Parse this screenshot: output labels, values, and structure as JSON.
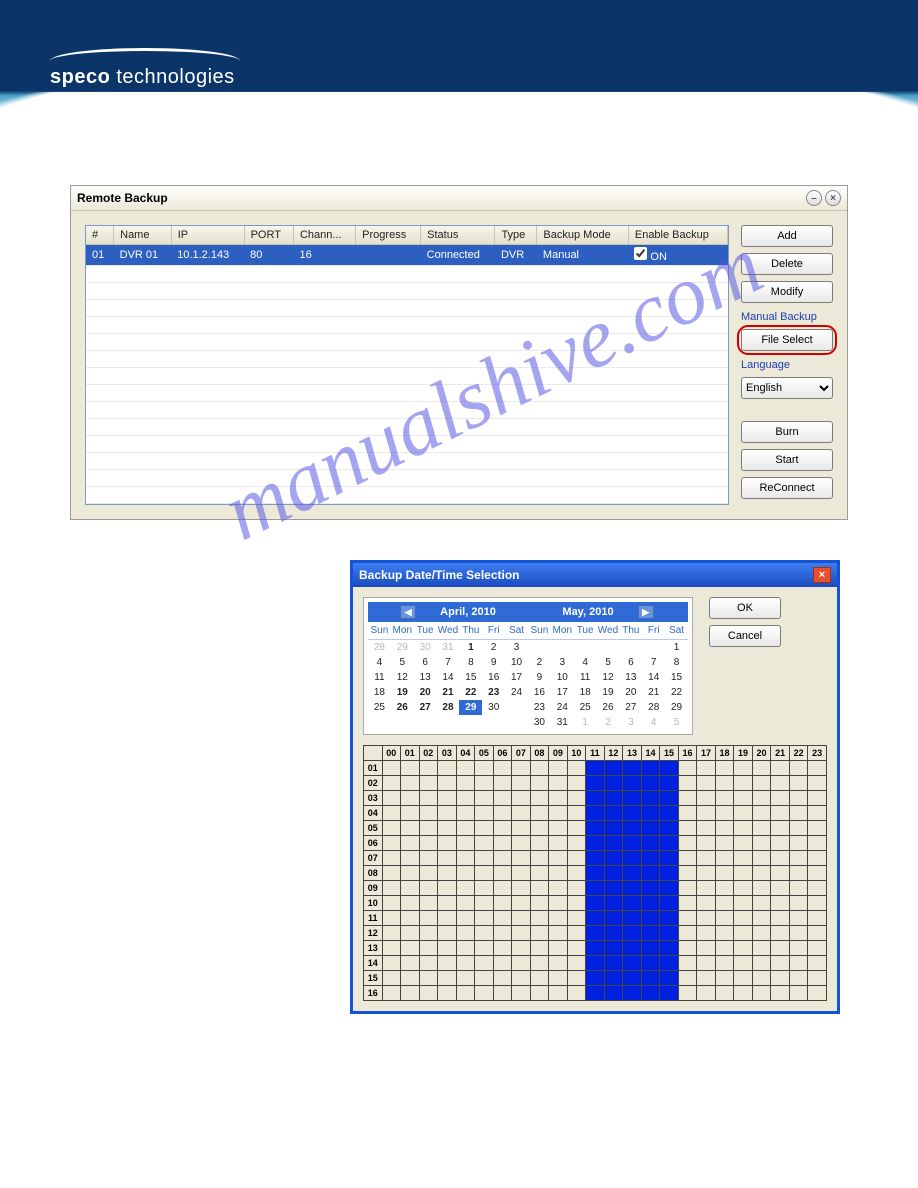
{
  "brand": {
    "name": "speco",
    "suffix": " technologies"
  },
  "watermark": "manualshive.com",
  "remoteBackup": {
    "title": "Remote Backup",
    "minIcon": "–",
    "closeIcon": "×",
    "headers": [
      "#",
      "Name",
      "IP",
      "PORT",
      "Chann...",
      "Progress",
      "Status",
      "Type",
      "Backup Mode",
      "Enable Backup"
    ],
    "row": {
      "num": "01",
      "name": "DVR 01",
      "ip": "10.1.2.143",
      "port": "80",
      "chan": "16",
      "progress": "",
      "status": "Connected",
      "type": "DVR",
      "mode": "Manual",
      "enable": "ON"
    },
    "buttons": {
      "add": "Add",
      "delete": "Delete",
      "modify": "Modify",
      "manualBackup": "Manual Backup",
      "fileSelect": "File Select",
      "language": "Language",
      "langValue": "English",
      "burn": "Burn",
      "start": "Start",
      "reconnect": "ReConnect"
    }
  },
  "dateDialog": {
    "title": "Backup Date/Time Selection",
    "close": "×",
    "ok": "OK",
    "cancel": "Cancel",
    "dayHeaders": [
      "Sun",
      "Mon",
      "Tue",
      "Wed",
      "Thu",
      "Fri",
      "Sat"
    ],
    "calendars": [
      {
        "label": "April, 2010",
        "prev": true,
        "next": false,
        "days": [
          {
            "n": "28",
            "off": true
          },
          {
            "n": "29",
            "off": true
          },
          {
            "n": "30",
            "off": true
          },
          {
            "n": "31",
            "off": true
          },
          {
            "n": "1",
            "b": true
          },
          {
            "n": "2"
          },
          {
            "n": "3"
          },
          {
            "n": "4"
          },
          {
            "n": "5"
          },
          {
            "n": "6"
          },
          {
            "n": "7"
          },
          {
            "n": "8"
          },
          {
            "n": "9"
          },
          {
            "n": "10"
          },
          {
            "n": "11"
          },
          {
            "n": "12"
          },
          {
            "n": "13"
          },
          {
            "n": "14"
          },
          {
            "n": "15"
          },
          {
            "n": "16"
          },
          {
            "n": "17"
          },
          {
            "n": "18"
          },
          {
            "n": "19",
            "b": true
          },
          {
            "n": "20",
            "b": true
          },
          {
            "n": "21",
            "b": true
          },
          {
            "n": "22",
            "b": true
          },
          {
            "n": "23",
            "b": true
          },
          {
            "n": "24"
          },
          {
            "n": "25"
          },
          {
            "n": "26",
            "b": true
          },
          {
            "n": "27",
            "b": true
          },
          {
            "n": "28",
            "b": true
          },
          {
            "n": "29",
            "b": true,
            "today": true
          },
          {
            "n": "30"
          },
          {
            "n": ""
          }
        ]
      },
      {
        "label": "May, 2010",
        "prev": false,
        "next": true,
        "days": [
          {
            "n": ""
          },
          {
            "n": ""
          },
          {
            "n": ""
          },
          {
            "n": ""
          },
          {
            "n": ""
          },
          {
            "n": ""
          },
          {
            "n": "1"
          },
          {
            "n": "2"
          },
          {
            "n": "3"
          },
          {
            "n": "4"
          },
          {
            "n": "5"
          },
          {
            "n": "6"
          },
          {
            "n": "7"
          },
          {
            "n": "8"
          },
          {
            "n": "9"
          },
          {
            "n": "10"
          },
          {
            "n": "11"
          },
          {
            "n": "12"
          },
          {
            "n": "13"
          },
          {
            "n": "14"
          },
          {
            "n": "15"
          },
          {
            "n": "16"
          },
          {
            "n": "17"
          },
          {
            "n": "18"
          },
          {
            "n": "19"
          },
          {
            "n": "20"
          },
          {
            "n": "21"
          },
          {
            "n": "22"
          },
          {
            "n": "23"
          },
          {
            "n": "24"
          },
          {
            "n": "25"
          },
          {
            "n": "26"
          },
          {
            "n": "27"
          },
          {
            "n": "28"
          },
          {
            "n": "29"
          },
          {
            "n": "30"
          },
          {
            "n": "31"
          },
          {
            "n": "1",
            "off": true
          },
          {
            "n": "2",
            "off": true
          },
          {
            "n": "3",
            "off": true
          },
          {
            "n": "4",
            "off": true
          },
          {
            "n": "5",
            "off": true
          }
        ]
      }
    ],
    "hourHeaders": [
      "00",
      "01",
      "02",
      "03",
      "04",
      "05",
      "06",
      "07",
      "08",
      "09",
      "10",
      "11",
      "12",
      "13",
      "14",
      "15",
      "16",
      "17",
      "18",
      "19",
      "20",
      "21",
      "22",
      "23"
    ],
    "channels": [
      "01",
      "02",
      "03",
      "04",
      "05",
      "06",
      "07",
      "08",
      "09",
      "10",
      "11",
      "12",
      "13",
      "14",
      "15",
      "16"
    ],
    "filledHours": [
      11,
      12,
      13,
      14,
      15
    ]
  }
}
